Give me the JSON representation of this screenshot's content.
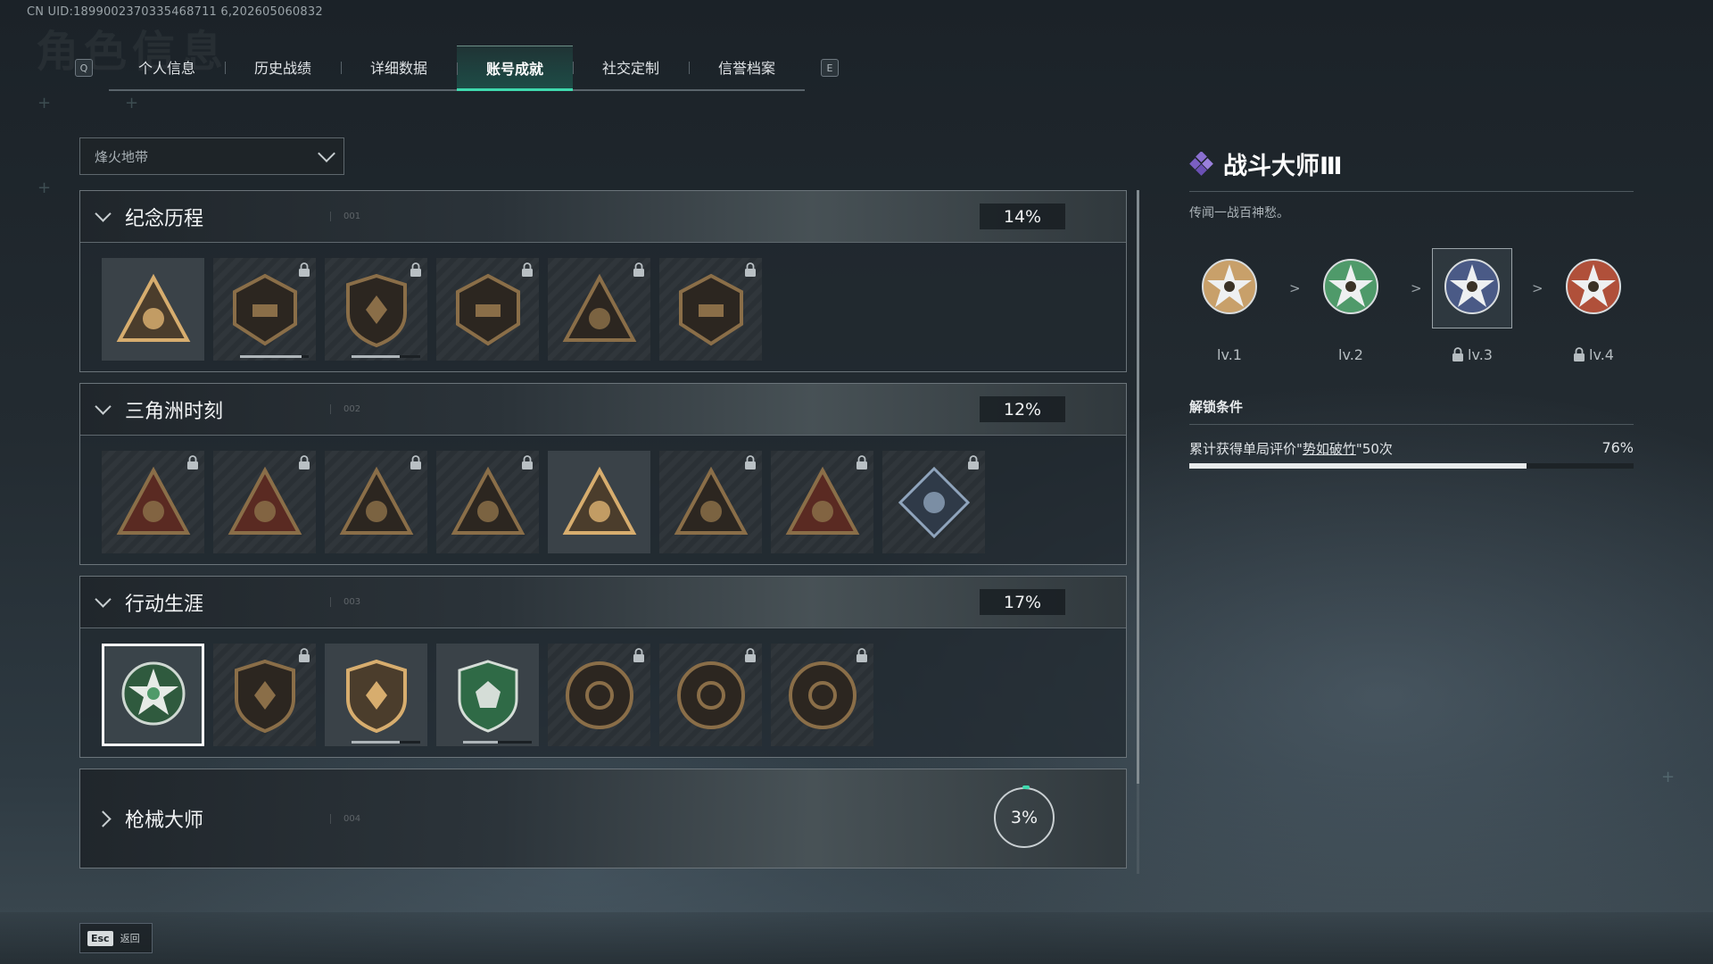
{
  "header": {
    "uid": "CN UID:1899002370335468711 6,202605060832",
    "ghost_title": "角色信息"
  },
  "tabs": {
    "prev_key": "Q",
    "next_key": "E",
    "items": [
      {
        "label": "个人信息",
        "active": false
      },
      {
        "label": "历史战绩",
        "active": false
      },
      {
        "label": "详细数据",
        "active": false
      },
      {
        "label": "账号成就",
        "active": true
      },
      {
        "label": "社交定制",
        "active": false
      },
      {
        "label": "信誉档案",
        "active": false
      }
    ]
  },
  "filter": {
    "selected": "烽火地带"
  },
  "sections": [
    {
      "title": "纪念历程",
      "num": "001",
      "percent": "14%",
      "expanded": true,
      "badges": [
        {
          "icon": "triangle-shield-badge-icon",
          "locked": false,
          "progress": 0
        },
        {
          "icon": "helicopter-badge-icon",
          "locked": true,
          "progress": 0.9
        },
        {
          "icon": "hex-shield-badge-icon",
          "locked": true,
          "progress": 0.7
        },
        {
          "icon": "tank-badge-icon",
          "locked": true,
          "progress": 0
        },
        {
          "icon": "soldier-triangle-badge-icon",
          "locked": true,
          "progress": 0
        },
        {
          "icon": "crossed-rifles-badge-icon",
          "locked": true,
          "progress": 0
        }
      ]
    },
    {
      "title": "三角洲时刻",
      "num": "002",
      "percent": "12%",
      "expanded": true,
      "badges": [
        {
          "icon": "supply-triangle-badge-icon",
          "locked": true,
          "progress": 0
        },
        {
          "icon": "vest-triangle-badge-icon",
          "locked": true,
          "progress": 0
        },
        {
          "icon": "swimmer-triangle-badge-icon",
          "locked": true,
          "progress": 0
        },
        {
          "icon": "gear-triangle-badge-icon",
          "locked": true,
          "progress": 0
        },
        {
          "icon": "squad-triangle-badge-icon",
          "locked": false,
          "progress": 0
        },
        {
          "icon": "team-triangle-badge-icon",
          "locked": true,
          "progress": 0
        },
        {
          "icon": "diver-triangle-badge-icon",
          "locked": true,
          "progress": 0
        },
        {
          "icon": "flower-diamond-badge-icon",
          "locked": true,
          "progress": 0
        }
      ]
    },
    {
      "title": "行动生涯",
      "num": "003",
      "percent": "17%",
      "expanded": true,
      "badges": [
        {
          "icon": "green-star-skull-badge-icon",
          "locked": false,
          "progress": 0,
          "selected": true
        },
        {
          "icon": "wing-shield-badge-icon",
          "locked": true,
          "progress": 0
        },
        {
          "icon": "bullet-shield-badge-icon",
          "locked": false,
          "progress": 0.7
        },
        {
          "icon": "green-shield-badge-icon",
          "locked": false,
          "progress": 0.5
        },
        {
          "icon": "helmet-circle-badge-icon",
          "locked": true,
          "progress": 0
        },
        {
          "icon": "skull-circle-badge-icon",
          "locked": true,
          "progress": 0
        },
        {
          "icon": "eye-circle-badge-icon",
          "locked": true,
          "progress": 0
        }
      ]
    },
    {
      "title": "枪械大师",
      "num": "004",
      "percent": "3%",
      "expanded": false,
      "badges": []
    }
  ],
  "detail": {
    "name": "战斗大师Ⅲ",
    "description": "传闻一战百神愁。",
    "levels": [
      {
        "label": "lv.1",
        "locked": false,
        "color": "#c8a06a"
      },
      {
        "label": "lv.2",
        "locked": false,
        "color": "#4f9a6a"
      },
      {
        "label": "lv.3",
        "locked": true,
        "color": "#4a5a86",
        "selected": true
      },
      {
        "label": "lv.4",
        "locked": true,
        "color": "#b0503a"
      }
    ],
    "unlock_heading": "解锁条件",
    "requirement_prefix": "累计获得单局评价\"",
    "requirement_highlight": "势如破竹",
    "requirement_suffix": "\"50次",
    "progress_label": "76%",
    "progress_value": 0.76
  },
  "footer": {
    "esc_key": "Esc",
    "esc_label": "返回"
  },
  "colors": {
    "accent": "#3fd9ae",
    "badge_gold": "#c49a5e",
    "badge_green": "#4f9a6a"
  }
}
